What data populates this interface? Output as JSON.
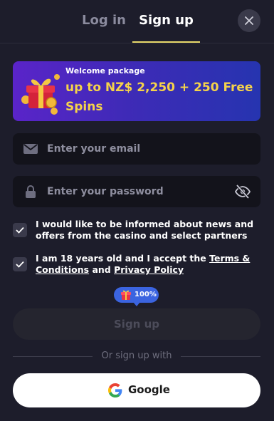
{
  "tabs": {
    "login_label": "Log in",
    "signup_label": "Sign up",
    "active": "signup"
  },
  "banner": {
    "subtitle": "Welcome package",
    "title": "up to NZ$ 2,250 + 250 Free Spins"
  },
  "form": {
    "email_placeholder": "Enter your email",
    "password_placeholder": "Enter your password",
    "consent_news": {
      "checked": true,
      "text": "I would like to be informed about news and offers from the casino and select partners"
    },
    "consent_age": {
      "checked": true,
      "text_before": "I am 18 years old and I accept the ",
      "terms_link": "Terms & Conditions",
      "text_middle": " and ",
      "privacy_link": "Privacy Policy"
    }
  },
  "promo_badge": {
    "value": "100%",
    "icon": "gift-icon"
  },
  "signup_button": {
    "label": "Sign up",
    "enabled": false
  },
  "social": {
    "divider_text": "Or sign up with",
    "google_label": "Google"
  },
  "colors": {
    "background": "#1d1d2b",
    "accent_underline": "#e7d96a",
    "banner_title": "#f5d34a",
    "badge": "#3b64e0"
  }
}
